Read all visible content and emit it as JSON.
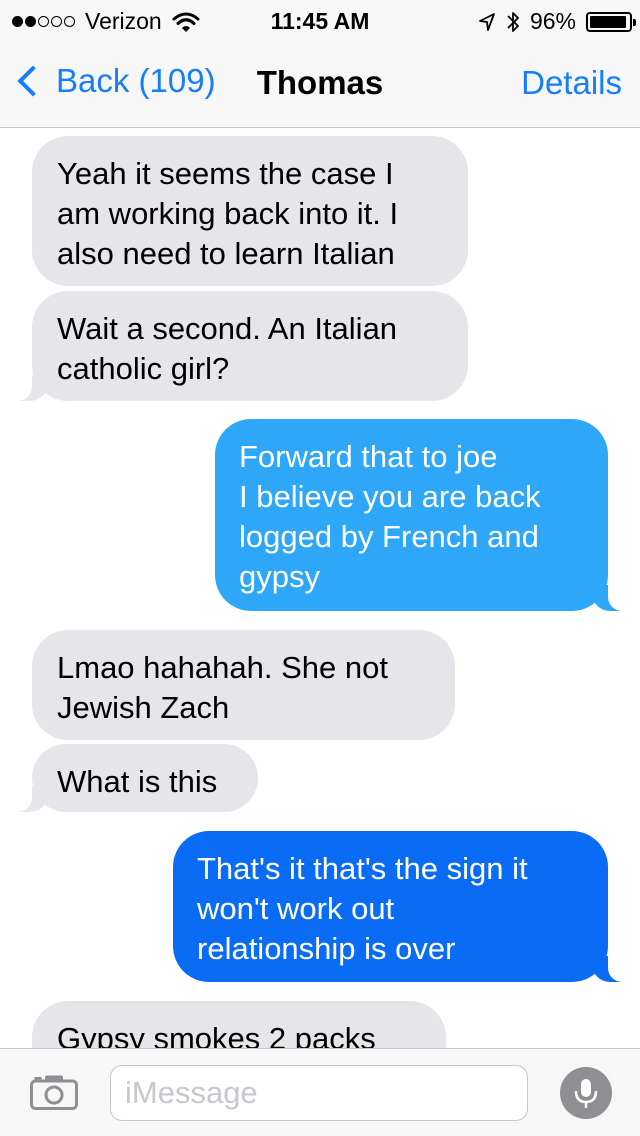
{
  "status_bar": {
    "signal_filled": 2,
    "signal_total": 5,
    "carrier": "Verizon",
    "time": "11:45 AM",
    "battery_text": "96%",
    "battery_level": 0.96
  },
  "nav": {
    "back_label": "Back (109)",
    "title": "Thomas",
    "details_label": "Details"
  },
  "messages": [
    {
      "direction": "incoming",
      "text": "Yeah it seems the case I\nam working back into it. I\nalso need to learn Italian"
    },
    {
      "direction": "incoming",
      "text": "Wait a second. An Italian\ncatholic girl?"
    },
    {
      "direction": "outgoing",
      "text": "Forward that to joe\nI believe you are back\nlogged by French and\ngypsy"
    },
    {
      "direction": "incoming",
      "text": "Lmao hahahah. She not\nJewish Zach"
    },
    {
      "direction": "incoming",
      "text": "What is this"
    },
    {
      "direction": "outgoing",
      "text": "That's it that's the sign it\nwon't work out\nrelationship is over"
    },
    {
      "direction": "incoming",
      "text": "Gypsy smokes 2 packs"
    }
  ],
  "input_bar": {
    "placeholder": "iMessage"
  },
  "icons": {
    "camera": "camera-icon",
    "microphone": "microphone-icon",
    "wifi": "wifi-icon",
    "location": "location-arrow-icon",
    "bluetooth": "bluetooth-icon",
    "back": "chevron-left-icon"
  },
  "colors": {
    "ios_blue": "#157efb",
    "outgoing_top": "#2ea7f8",
    "outgoing_bottom": "#0a6cf5",
    "incoming_bubble": "#e5e5ea",
    "bar_background": "#f7f7f8"
  }
}
